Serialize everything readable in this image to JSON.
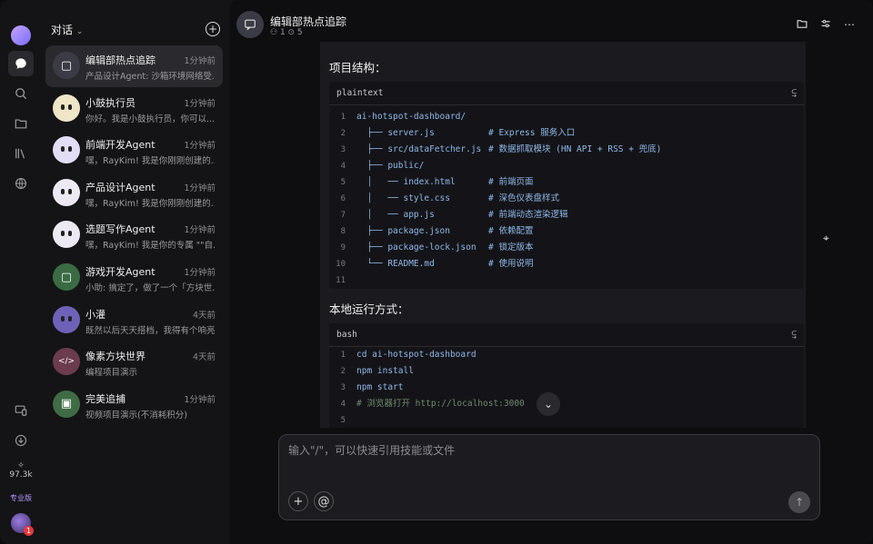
{
  "sidebar": {
    "credits": "97.3k",
    "plan": "专业版",
    "notification_count": "1"
  },
  "list": {
    "title": "对话",
    "items": [
      {
        "name": "编辑部热点追踪",
        "time": "1分钟前",
        "snippet": "产品设计Agent: 沙箱环境网络受...",
        "color": "#3b3b45",
        "glyph": "▢"
      },
      {
        "name": "小鼓执行员",
        "time": "1分钟前",
        "snippet": "你好。我是小鼓执行员，你可以...",
        "color": "#efe6c8",
        "glyph": ""
      },
      {
        "name": "前端开发Agent",
        "time": "1分钟前",
        "snippet": "嘿，RayKim! 我是你刚刚创建的...",
        "color": "#e2dcf5",
        "glyph": ""
      },
      {
        "name": "产品设计Agent",
        "time": "1分钟前",
        "snippet": "嘿，RayKim! 我是你刚刚创建的...",
        "color": "#ece9f3",
        "glyph": ""
      },
      {
        "name": "选题写作Agent",
        "time": "1分钟前",
        "snippet": "嘿，RayKim! 我是你的专属 \"\"自...",
        "color": "#ece9f3",
        "glyph": ""
      },
      {
        "name": "游戏开发Agent",
        "time": "1分钟前",
        "snippet": "小助: 搞定了，做了一个「方块世...",
        "color": "#3a6b43",
        "glyph": "▢"
      },
      {
        "name": "小灌",
        "time": "4天前",
        "snippet": "既然以后天天搭档，我得有个响亮...",
        "color": "#6d62b8",
        "glyph": ""
      },
      {
        "name": "像素方块世界",
        "time": "4天前",
        "snippet": "编程项目演示",
        "color": "#6b3b4e",
        "glyph": "</>"
      },
      {
        "name": "完美追捕",
        "time": "1分钟前",
        "snippet": "视频项目演示(不消耗积分)",
        "color": "#3f6b45",
        "glyph": "▣"
      }
    ]
  },
  "chat": {
    "title": "编辑部热点追踪",
    "meta": "1 ⊙ 5"
  },
  "content": {
    "section1": "项目结构：",
    "code1_lang": "plaintext",
    "code1_lines": [
      {
        "n": "1",
        "t": "ai-hotspot-dashboard/",
        "c": ""
      },
      {
        "n": "2",
        "t": "  ├── server.js",
        "c": "# Express 服务入口"
      },
      {
        "n": "3",
        "t": "  ├── src/dataFetcher.js",
        "c": "# 数据抓取模块 (HN API + RSS + 兜底)"
      },
      {
        "n": "4",
        "t": "  ├── public/",
        "c": ""
      },
      {
        "n": "5",
        "t": "  │   ── index.html",
        "c": "# 前端页面"
      },
      {
        "n": "6",
        "t": "  │   ── style.css",
        "c": "# 深色仪表盘样式"
      },
      {
        "n": "7",
        "t": "  │   ── app.js",
        "c": "# 前端动态渲染逻辑"
      },
      {
        "n": "8",
        "t": "  ├── package.json",
        "c": "# 依赖配置"
      },
      {
        "n": "9",
        "t": "  ├── package-lock.json",
        "c": "# 锁定版本"
      },
      {
        "n": "10",
        "t": "  └── README.md",
        "c": "# 使用说明"
      },
      {
        "n": "11",
        "t": "",
        "c": ""
      }
    ],
    "section2": "本地运行方式：",
    "code2_lang": "bash",
    "code2_lines": [
      {
        "n": "1",
        "t": "cd ai-hotspot-dashboard",
        "c": ""
      },
      {
        "n": "2",
        "t": "npm install",
        "c": ""
      },
      {
        "n": "3",
        "t": "npm start",
        "c": ""
      },
      {
        "n": "4",
        "t": "# 浏览器打开 http://localhost:3000",
        "c": ""
      },
      {
        "n": "5",
        "t": "",
        "c": ""
      }
    ]
  },
  "composer": {
    "placeholder": "输入\"/\"，可以快速引用技能或文件"
  }
}
